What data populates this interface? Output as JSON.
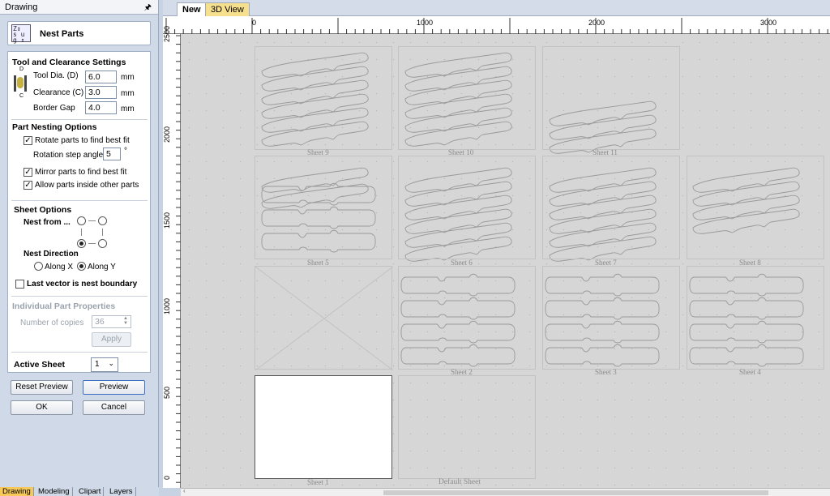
{
  "panel": {
    "title": "Drawing",
    "pin_icon": "pin-icon",
    "header_title": "Nest Parts",
    "header_icon_text": "Z↕ g↕",
    "tool_section": {
      "title": "Tool and Clearance Settings",
      "tool_dia_label": "Tool Dia. (D)",
      "tool_dia_value": "6.0",
      "clearance_label": "Clearance (C)",
      "clearance_value": "3.0",
      "border_gap_label": "Border Gap",
      "border_gap_value": "4.0",
      "unit": "mm",
      "d_letter": "D",
      "c_letter": "C"
    },
    "nesting_section": {
      "title": "Part Nesting Options",
      "rotate_label": "Rotate parts to find best fit",
      "rotate_checked": true,
      "rotation_step_label": "Rotation step angle",
      "rotation_step_value": "5",
      "degree": "°",
      "mirror_label": "Mirror parts to find best fit",
      "mirror_checked": true,
      "allow_inside_label": "Allow parts inside other parts",
      "allow_inside_checked": true
    },
    "sheet_section": {
      "title": "Sheet Options",
      "nest_from_label": "Nest from ...",
      "nest_direction_label": "Nest Direction",
      "along_x_label": "Along X",
      "along_y_label": "Along Y",
      "selected_direction": "Along Y",
      "last_vector_label": "Last vector is nest boundary",
      "last_vector_checked": false
    },
    "part_section": {
      "title": "Individual Part Properties",
      "copies_label": "Number of copies",
      "copies_value": "36",
      "apply_label": "Apply"
    },
    "active_sheet_label": "Active Sheet",
    "active_sheet_value": "1",
    "reset_preview_label": "Reset Preview",
    "preview_label": "Preview",
    "ok_label": "OK",
    "cancel_label": "Cancel",
    "bottom_tabs": [
      "Drawing",
      "Modeling",
      "Clipart",
      "Layers"
    ]
  },
  "doc_tabs": [
    "New",
    "3D View"
  ],
  "ruler": {
    "top_labels": [
      "0",
      "1000",
      "2000",
      "3000"
    ],
    "left_labels": [
      "2500",
      "2000",
      "1500",
      "1000",
      "500",
      "0"
    ]
  },
  "sheets": {
    "labels": [
      "Sheet 9",
      "Sheet 10",
      "Sheet 11",
      "Sheet 5",
      "Sheet 6",
      "Sheet 7",
      "Sheet 8",
      "Sheet 2",
      "Sheet 3",
      "Sheet 4",
      "Sheet 1",
      "Default Sheet"
    ]
  },
  "colors": {
    "part_outline": "#9a9a9a",
    "active_part_outline": "#5a2a2a",
    "tab_active": "#f7c95a"
  }
}
